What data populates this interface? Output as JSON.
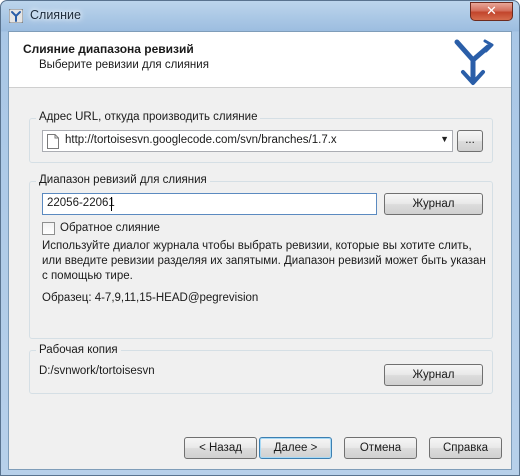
{
  "window": {
    "title": "Слияние",
    "close_glyph": "✕"
  },
  "header": {
    "title": "Слияние диапазона ревизий",
    "subtitle": "Выберите ревизии для слияния",
    "logo_icon": "tortoisesvn-merge-icon"
  },
  "url_group": {
    "label": "Адрес URL, откуда производить слияние",
    "value": "http://tortoisesvn.googlecode.com/svn/branches/1.7.x",
    "browse_label": "..."
  },
  "range_group": {
    "label": "Диапазон ревизий для слияния",
    "value": "22056-22061",
    "log_button": "Журнал",
    "reverse_checkbox": {
      "label": "Обратное слияние",
      "checked": false
    },
    "help_text": "Используйте диалог журнала чтобы выбрать ревизии, которые вы хотите слить, или введите ревизии разделяя их запятыми. Диапазон ревизий может быть указан с помощью тире.",
    "example": "Образец: 4-7,9,11,15-HEAD@pegrevision"
  },
  "working_copy": {
    "label": "Рабочая копия",
    "path": "D:/svnwork/tortoisesvn",
    "log_button": "Журнал"
  },
  "footer": {
    "back": "< Назад",
    "next": "Далее >",
    "cancel": "Отмена",
    "help": "Справка"
  },
  "colors": {
    "accent": "#2a5ea8",
    "window_frame": "#a9c7e6",
    "panel": "#f0f0f0"
  }
}
